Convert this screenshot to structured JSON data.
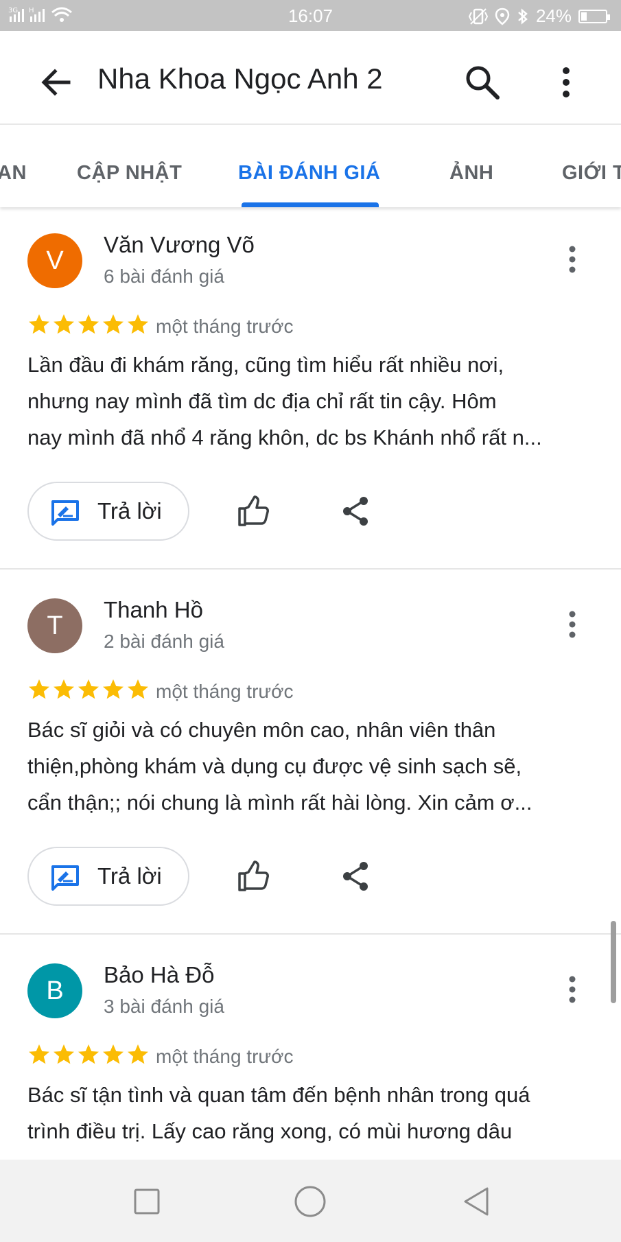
{
  "status_bar": {
    "network": "3G H",
    "time": "16:07",
    "battery_percent": "24%",
    "battery_level": 0.24
  },
  "app_bar": {
    "title": "Nha Khoa Ngọc Anh 2",
    "icons": [
      "back-arrow-icon",
      "search-icon",
      "more-vert-icon"
    ]
  },
  "tabs": [
    {
      "label": "AN",
      "active": false
    },
    {
      "label": "CẬP NHẬT",
      "active": false
    },
    {
      "label": "BÀI ĐÁNH GIÁ",
      "active": true
    },
    {
      "label": "ẢNH",
      "active": false
    },
    {
      "label": "GIỚI T",
      "active": false
    }
  ],
  "reply_label": "Trả lời",
  "colors": {
    "accent": "#1a73e8",
    "star": "#fbbc04"
  },
  "reviews": [
    {
      "initial": "V",
      "name": "Văn Vương Võ",
      "count": "6 bài đánh giá",
      "rating": 5,
      "time": "một tháng trước",
      "avatar_color": "#ef6c00",
      "lines": [
        "Lần đầu đi khám răng, cũng tìm hiểu rất nhiều nơi,",
        "nhưng nay mình đã tìm dc địa chỉ rất tin cậy. Hôm",
        "nay mình đã nhổ 4 răng khôn, dc bs Khánh nhổ rất n..."
      ]
    },
    {
      "initial": "T",
      "name": "Thanh Hồ",
      "count": "2 bài đánh giá",
      "rating": 5,
      "time": "một tháng trước",
      "avatar_color": "#8d6e63",
      "lines": [
        "Bác sĩ giỏi và có chuyên môn cao, nhân viên thân",
        "thiện,phòng khám và dụng cụ được vệ sinh sạch sẽ,",
        "cẩn thận;; nói chung là mình rất hài lòng. Xin cảm ơ..."
      ]
    },
    {
      "initial": "B",
      "name": "Bảo Hà Đỗ",
      "count": "3 bài đánh giá",
      "rating": 5,
      "time": "một tháng trước",
      "avatar_color": "#0097a7",
      "lines": [
        "Bác sĩ tận tình và quan tâm đến bệnh nhân trong quá",
        "trình điều trị. Lấy cao răng xong, có mùi hương dâu"
      ]
    }
  ],
  "nav_bar": {
    "icons": [
      "recent-apps-icon",
      "home-icon",
      "back-nav-icon"
    ]
  }
}
